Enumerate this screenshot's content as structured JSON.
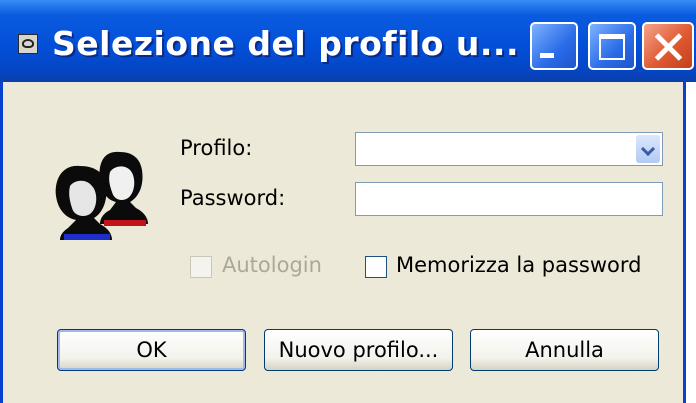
{
  "window": {
    "title": "Selezione del profilo u...",
    "controls": [
      "minimize-icon",
      "maximize-icon",
      "close-icon"
    ]
  },
  "form": {
    "profile_label": "Profilo:",
    "profile_value": "",
    "password_label": "Password:",
    "password_value": "",
    "autologin_label": "Autologin",
    "autologin_enabled": false,
    "remember_label": "Memorizza la password",
    "remember_checked": false
  },
  "buttons": {
    "ok": "OK",
    "new_profile": "Nuovo profilo...",
    "cancel": "Annulla"
  },
  "icons": {
    "app": "app-icon",
    "users": "users-icon"
  },
  "colors": {
    "titlebar": "#0350d8",
    "dialog_bg": "#ece9d8",
    "close_button": "#e05a33"
  }
}
